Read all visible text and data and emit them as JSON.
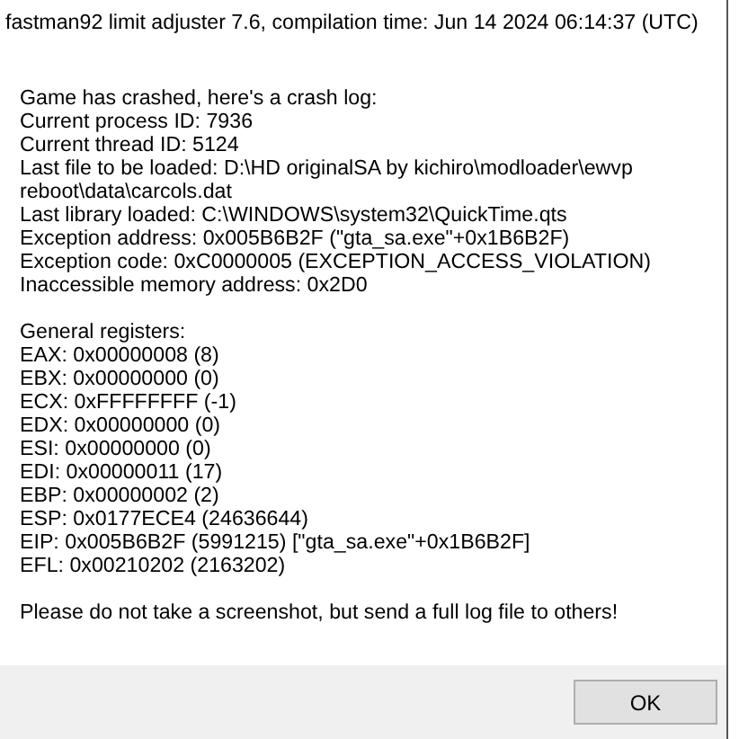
{
  "window": {
    "title": "fastman92 limit adjuster 7.6, compilation time: Jun 14 2024 06:14:37 (UTC)"
  },
  "message": {
    "groups": [
      [
        "Game has crashed, here's a crash log:",
        "Current process ID: 7936",
        "Current thread ID: 5124",
        "Last file to be loaded: D:\\HD originalSA by kichiro\\modloader\\ewvp",
        "reboot\\data\\carcols.dat",
        "Last library loaded: C:\\WINDOWS\\system32\\QuickTime.qts",
        "Exception address: 0x005B6B2F (\"gta_sa.exe\"+0x1B6B2F)",
        "Exception code: 0xC0000005 (EXCEPTION_ACCESS_VIOLATION)",
        "Inaccessible memory address: 0x2D0"
      ],
      [
        "General registers:",
        "EAX: 0x00000008 (8)",
        "EBX: 0x00000000 (0)",
        "ECX: 0xFFFFFFFF (-1)",
        "EDX: 0x00000000 (0)",
        "ESI: 0x00000000 (0)",
        "EDI: 0x00000011 (17)",
        "EBP: 0x00000002 (2)",
        "ESP: 0x0177ECE4 (24636644)",
        "EIP: 0x005B6B2F (5991215) [\"gta_sa.exe\"+0x1B6B2F]",
        "EFL: 0x00210202 (2163202)"
      ],
      [
        "Please do not take a screenshot, but send a full log file to others!"
      ]
    ]
  },
  "buttons": [
    {
      "label": "OK"
    }
  ]
}
